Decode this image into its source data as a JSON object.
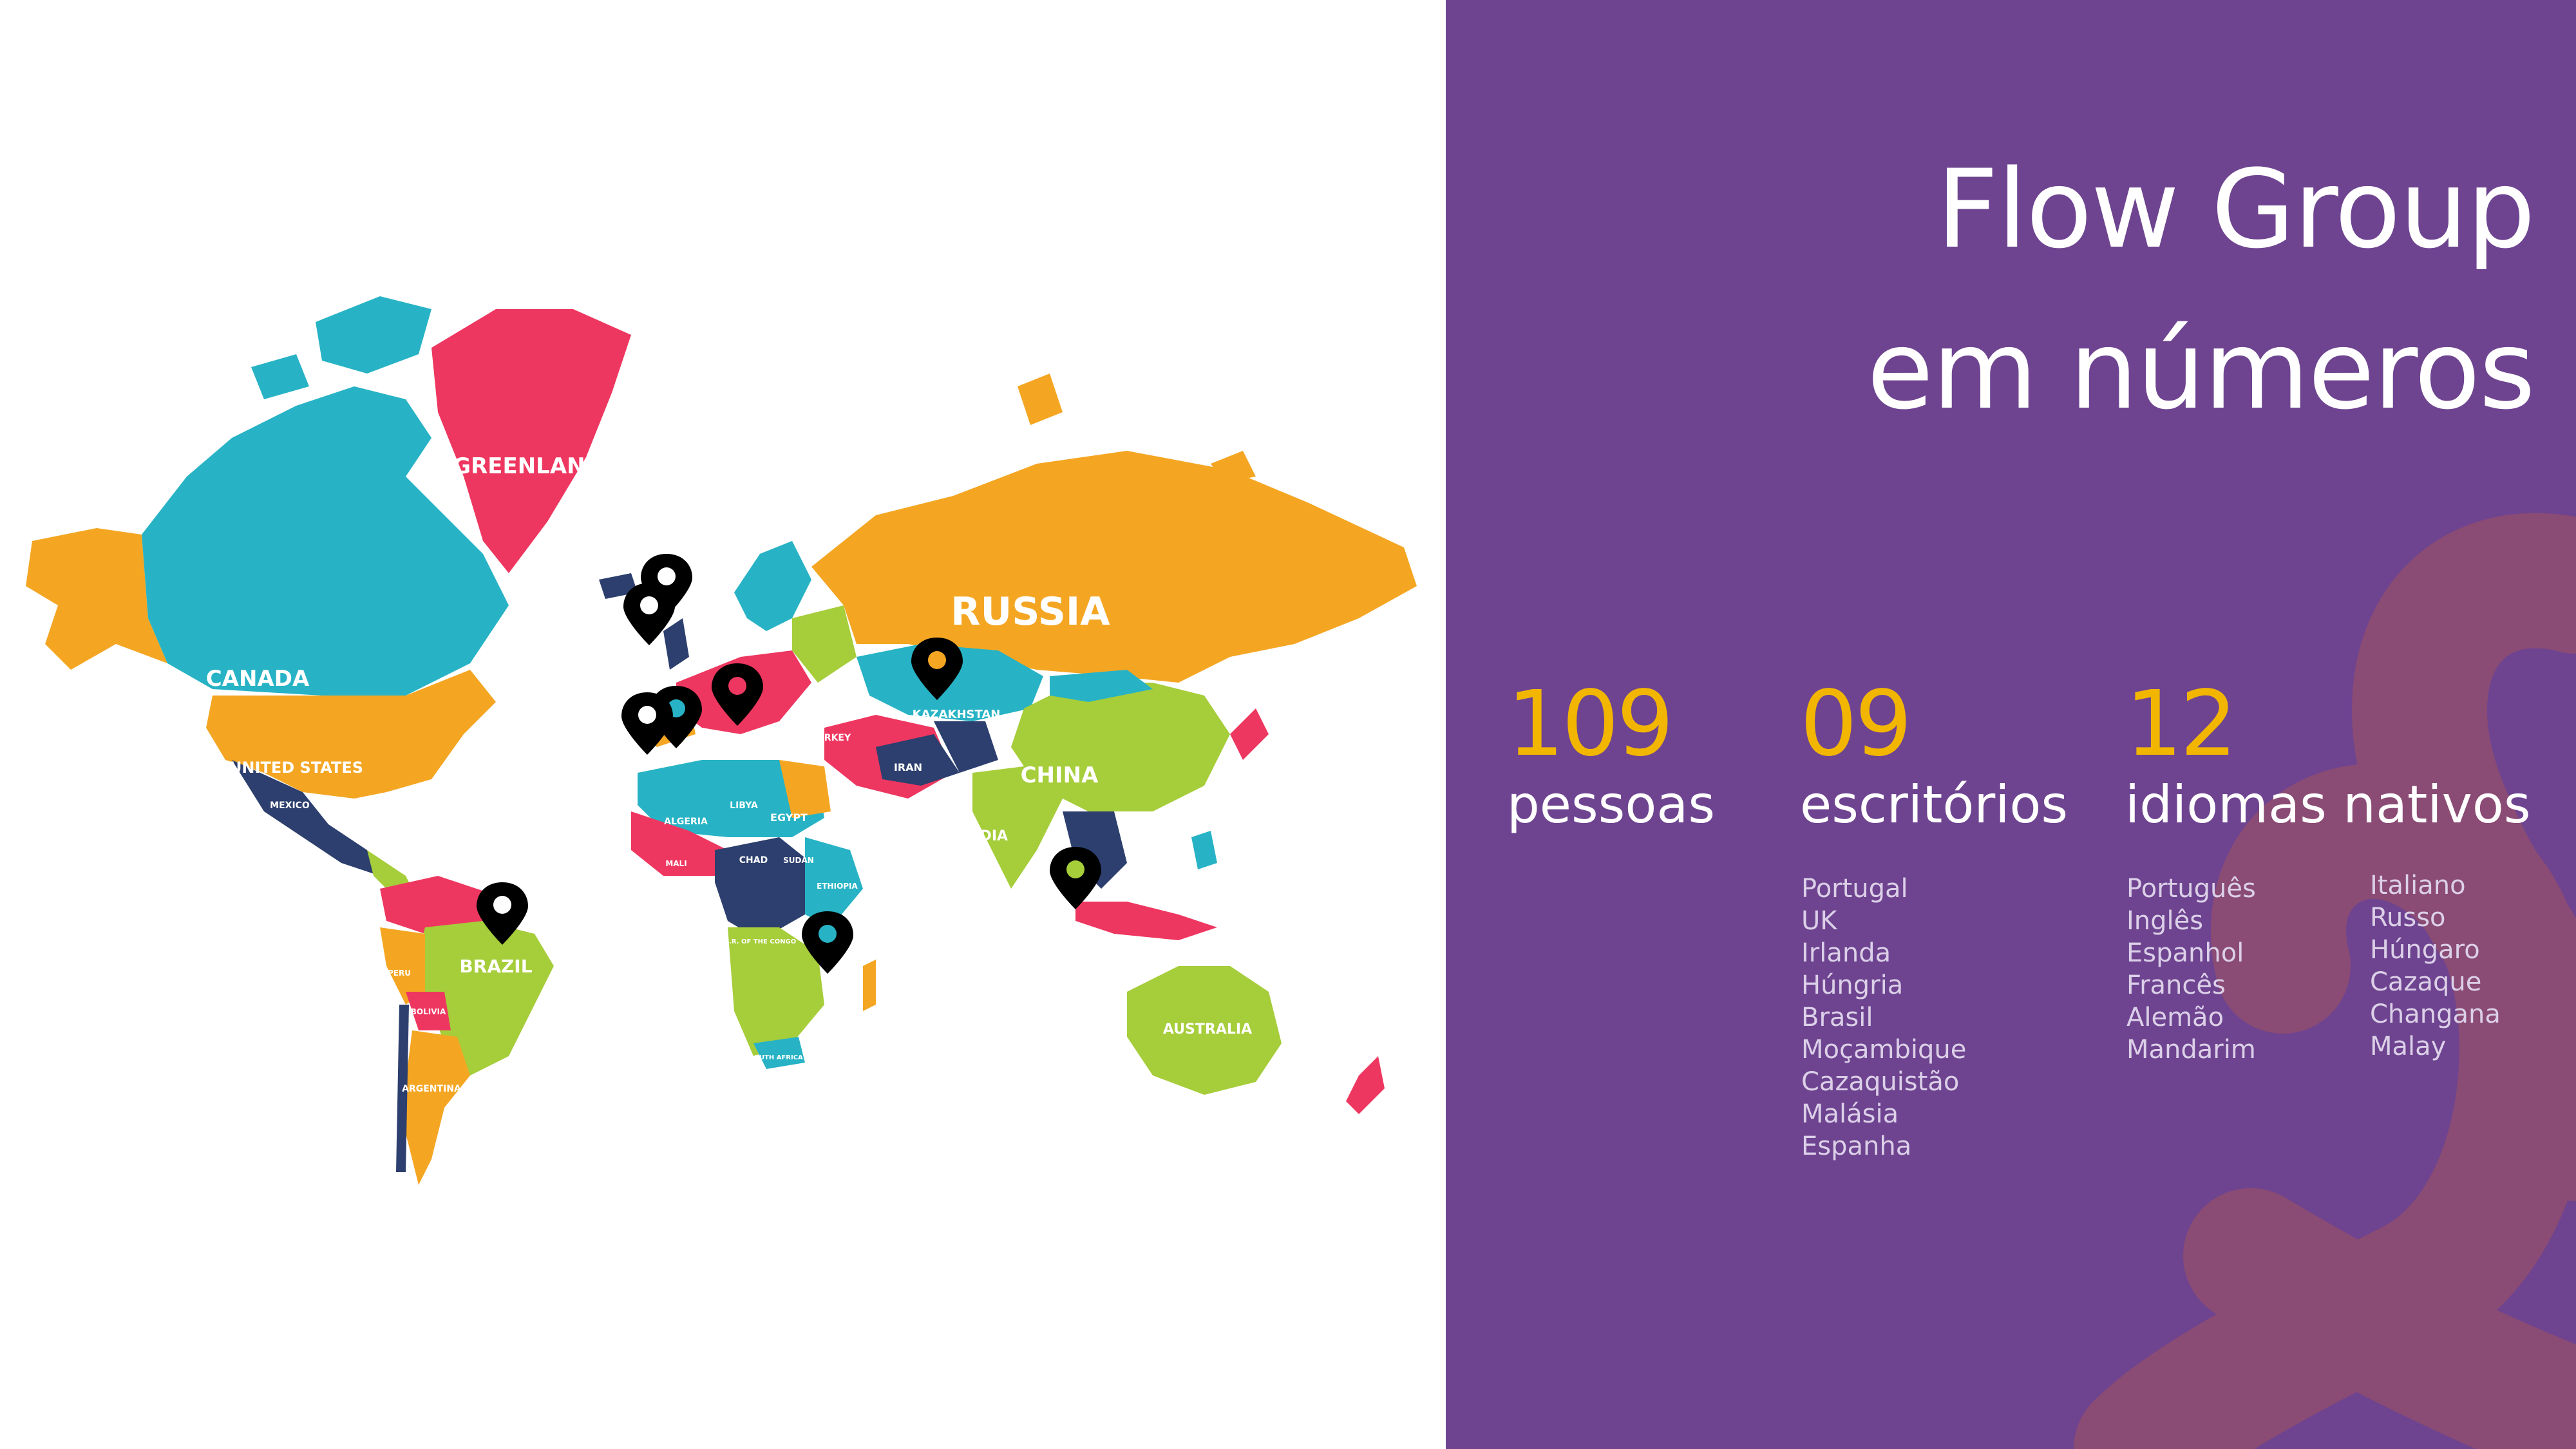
{
  "title": {
    "line1": "Flow Group",
    "line2": "em números"
  },
  "map": {
    "labels": {
      "greenland": "GREENLAND",
      "russia": "RUSSIA",
      "canada": "CANADA",
      "united_states": "UNITED STATES",
      "china": "CHINA",
      "kazakhstan": "KAZAKHSTAN",
      "india": "INDIA",
      "brazil": "BRAZIL",
      "australia": "AUSTRALIA",
      "egypt": "EGYPT",
      "libya": "LIBYA",
      "algeria": "ALGERIA",
      "chad": "CHAD",
      "mali": "MALI",
      "sudan": "SUDAN",
      "ethiopia": "ETHIOPIA",
      "iran": "IRAN",
      "turkey": "TURKEY",
      "mexico": "MEXICO",
      "peru": "PERU",
      "bolivia": "BOLIVIA",
      "argentina": "ARGENTINA",
      "drc": "D.R. OF THE CONGO",
      "south_africa": "SOUTH AFRICA"
    },
    "colors": {
      "orange": "#f4a623",
      "teal": "#27b3c5",
      "pink": "#ee3760",
      "green": "#a6cd3a",
      "navy": "#2c3f6e",
      "pin": "#000000"
    }
  },
  "stats": [
    {
      "number": "109",
      "label": "pessoas"
    },
    {
      "number": "09",
      "label": "escritórios"
    },
    {
      "number": "12",
      "label": "idiomas nativos"
    }
  ],
  "offices": [
    "Portugal",
    "UK",
    "Irlanda",
    "Húngria",
    "Brasil",
    "Moçambique",
    "Cazaquistão",
    "Malásia",
    "Espanha"
  ],
  "languages_col1": [
    "Português",
    "Inglês",
    "Espanhol",
    "Francês",
    "Alemão",
    "Mandarim"
  ],
  "languages_col2": [
    "Italiano",
    "Russo",
    "Húngaro",
    "Cazaque",
    "Changana",
    "Malay"
  ],
  "colors": {
    "accent": "#f2b600",
    "background": "#6e4490",
    "ampersand": "#8a4b74"
  }
}
